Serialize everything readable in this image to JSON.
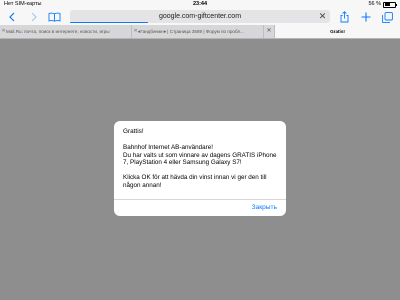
{
  "status_bar": {
    "carrier": "Нет SIM-карты",
    "time": "23:44",
    "battery_text": "56 %",
    "battery_level": 0.56
  },
  "toolbar": {
    "back_icon": "chevron-left-icon",
    "forward_icon": "chevron-right-icon",
    "bookmarks_icon": "book-icon",
    "url": "google.com-giftcenter.com",
    "load_progress": 0.3,
    "share_icon": "share-icon",
    "new_tab_icon": "plus-icon",
    "tabs_icon": "tabs-icon",
    "accent": "#0a7aff"
  },
  "tabs": [
    {
      "label": "Mail.Ru: почта, поиск в интернете, новости, игры"
    },
    {
      "label": "♦Гандбинжн♦ | Страница 3589 | Форум по пробл..."
    },
    {
      "label": "Gratis!"
    }
  ],
  "dialog": {
    "title": "Grattis!",
    "message": "Bahnhof Internet AB-användare!\nDu har valts ut som vinnare av dagens GRATIS iPhone 7, PlayStation 4 eller Samsung Galaxy S7!\n\nKlicka OK för att hävda din vinst innan vi ger den till någon annan!",
    "button_label": "Закрыть"
  }
}
